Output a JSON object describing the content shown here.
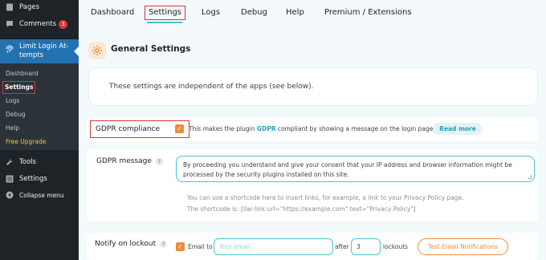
{
  "sidebar": {
    "pages_label": "Pages",
    "comments_label": "Comments",
    "comments_count": "3",
    "plugin_label": "Limit Login At-\ntempts",
    "submenu": {
      "dashboard": "Dashboard",
      "settings": "Settings",
      "logs": "Logs",
      "debug": "Debug",
      "help": "Help",
      "upgrade": "Free Upgrade"
    },
    "tools_label": "Tools",
    "settings_label": "Settings",
    "collapse_label": "Collapse menu"
  },
  "tabs": {
    "dashboard": "Dashboard",
    "settings": "Settings",
    "logs": "Logs",
    "debug": "Debug",
    "help": "Help",
    "premium": "Premium / Extensions"
  },
  "general": {
    "title": "General Settings",
    "info": "These settings are independent of the apps (see below)."
  },
  "gdpr": {
    "label": "GDPR compliance",
    "checked": true,
    "text_before": "This makes the plugin ",
    "link": "GDPR",
    "text_after": " compliant by showing a message on the login page.",
    "read_more": "Read more"
  },
  "gdpr_message": {
    "label": "GDPR message",
    "help": "?",
    "value": "By proceeding you understand and give your consent that your IP address and browser information might be processed by the security plugins installed on this site.",
    "hint1": "You can use a shortcode here to insert links, for example, a link to your Privacy Policy page.",
    "hint2": "The shortcode is: [llar-link url=\"https://example.com\" text=\"Privacy Policy\"]"
  },
  "lockout": {
    "label": "Notify on lockout",
    "help": "?",
    "checked": true,
    "email_to": "Email to",
    "email_placeholder": "Your email",
    "after": "after",
    "count": "3",
    "lockouts": "lockouts",
    "test_button": "Test Email Notifications"
  },
  "colors": {
    "sidebar_bg": "#1d2327",
    "active_menu": "#2271b1",
    "accent": "#4ac3d4",
    "orange": "#f08a3c",
    "highlight_outline": "#d63638"
  }
}
